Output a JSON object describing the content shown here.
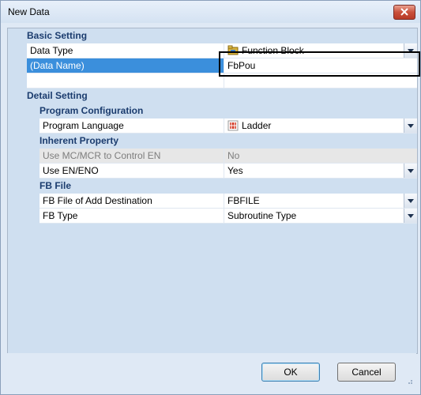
{
  "window": {
    "title": "New Data"
  },
  "basic": {
    "header": "Basic Setting",
    "data_type": {
      "name": "Data Type",
      "value": "Function Block",
      "icon": "function-block-icon"
    },
    "data_name": {
      "name": "(Data Name)",
      "value": "FbPou"
    }
  },
  "detail": {
    "header": "Detail Setting",
    "program_config": {
      "header": "Program Configuration",
      "language": {
        "name": "Program Language",
        "value": "Ladder",
        "icon": "ladder-icon"
      }
    },
    "inherent": {
      "header": "Inherent Property",
      "mc_mcr": {
        "name": "Use MC/MCR to Control EN",
        "value": "No"
      },
      "en_eno": {
        "name": "Use EN/ENO",
        "value": "Yes"
      }
    },
    "fb_file": {
      "header": "FB File",
      "destination": {
        "name": "FB File of Add Destination",
        "value": "FBFILE"
      },
      "fb_type": {
        "name": "FB Type",
        "value": "Subroutine Type"
      }
    }
  },
  "buttons": {
    "ok": "OK",
    "cancel": "Cancel"
  },
  "colors": {
    "selection": "#3b8fdc",
    "category": "#cfdff0",
    "highlight_border": "#000000"
  }
}
